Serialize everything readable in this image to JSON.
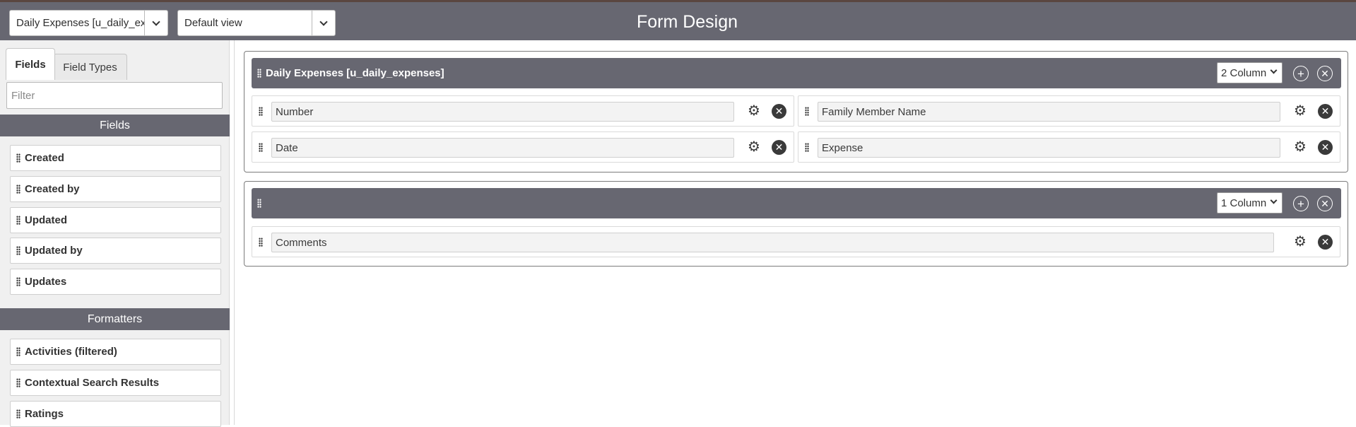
{
  "header": {
    "table_select": "Daily Expenses [u_daily_expenses]",
    "view_select": "Default view",
    "title": "Form Design"
  },
  "sidebar": {
    "tabs": [
      "Fields",
      "Field Types"
    ],
    "filter_placeholder": "Filter",
    "fields_heading": "Fields",
    "fields": [
      "Created",
      "Created by",
      "Updated",
      "Updated by",
      "Updates"
    ],
    "formatters_heading": "Formatters",
    "formatters": [
      "Activities (filtered)",
      "Contextual Search Results",
      "Ratings"
    ]
  },
  "sections": [
    {
      "title": "Daily Expenses [u_daily_expenses]",
      "columns": "2 Column",
      "fields": [
        "Number",
        "Family Member Name",
        "Date",
        "Expense"
      ]
    },
    {
      "title": "",
      "columns": "1 Column",
      "fields": [
        "Comments"
      ]
    }
  ],
  "icons": {
    "drag": "grip-icon",
    "add": "plus-circle-icon",
    "remove": "x-circle-icon",
    "settings": "gear-icon",
    "dropdown": "chevron-down-icon"
  },
  "colors": {
    "header_bg": "#676771",
    "sidebar_bg": "#f0f0f0",
    "accent_dark": "#3a3a3a"
  }
}
